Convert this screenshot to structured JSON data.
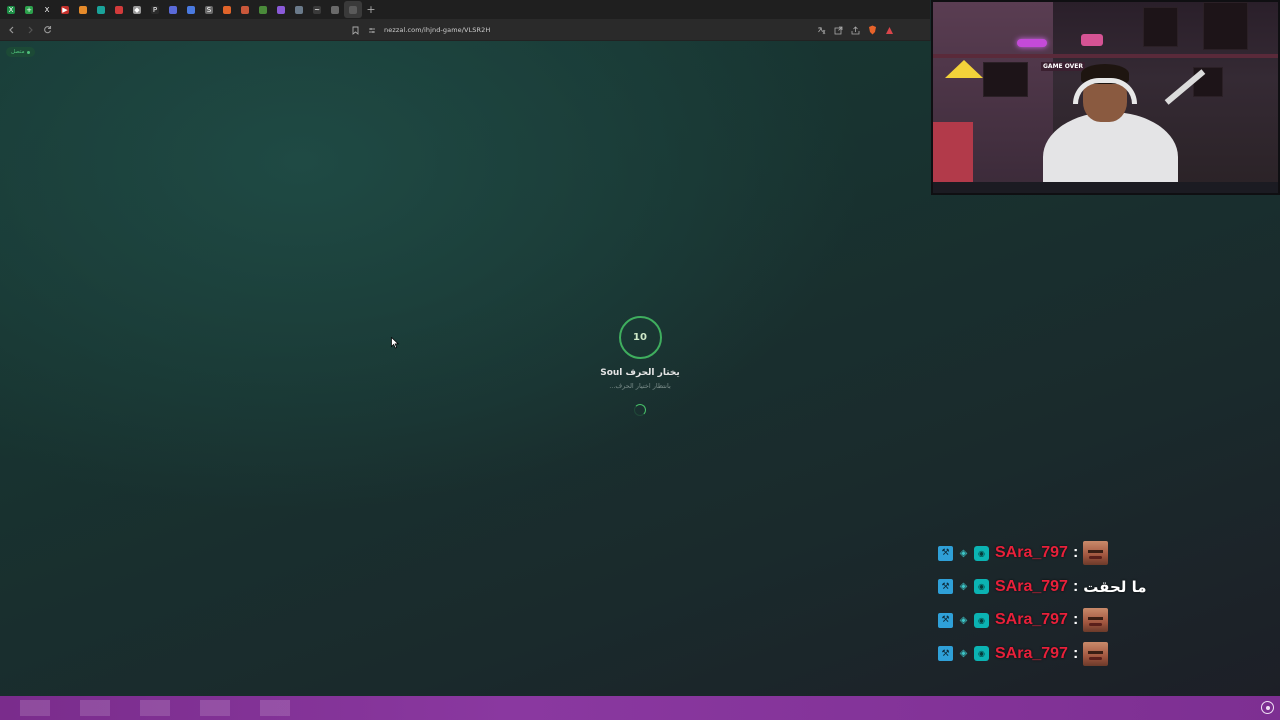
{
  "browser": {
    "tabs": [
      {
        "icon": "excel-icon",
        "color": "#1d8f46",
        "glyph": "X"
      },
      {
        "icon": "sheets-icon",
        "color": "#2ca24c",
        "glyph": "+"
      },
      {
        "icon": "x-twitter-icon",
        "color": "#1f1f1f",
        "glyph": "X"
      },
      {
        "icon": "youtube-icon",
        "color": "#c4302b",
        "glyph": "▶"
      },
      {
        "icon": "orange-site-icon",
        "color": "#e58a2a",
        "glyph": ""
      },
      {
        "icon": "teal-site-icon",
        "color": "#1aa39a",
        "glyph": ""
      },
      {
        "icon": "red-site-icon",
        "color": "#d33b3b",
        "glyph": ""
      },
      {
        "icon": "diamond-site-icon",
        "color": "#9a9a9a",
        "glyph": "◆"
      },
      {
        "icon": "p-site-icon",
        "color": "#2b2b2b",
        "glyph": "P"
      },
      {
        "icon": "gamepad-icon",
        "color": "#5a6ad8",
        "glyph": ""
      },
      {
        "icon": "globe-icon",
        "color": "#4a7ae0",
        "glyph": ""
      },
      {
        "icon": "sync-icon",
        "color": "#6a6a6a",
        "glyph": "S"
      },
      {
        "icon": "orange-ring-icon",
        "color": "#e0642a",
        "glyph": ""
      },
      {
        "icon": "brick-site-icon",
        "color": "#c9573a",
        "glyph": ""
      },
      {
        "icon": "map-site-icon",
        "color": "#4a8a3a",
        "glyph": ""
      },
      {
        "icon": "purple-game-icon",
        "color": "#8a5ad8",
        "glyph": ""
      },
      {
        "icon": "chat-site-icon",
        "color": "#6a7a8a",
        "glyph": ""
      },
      {
        "icon": "wave-site-icon",
        "color": "#3a3a3a",
        "glyph": "~"
      },
      {
        "icon": "grid-site-icon",
        "color": "#6a6a6a",
        "glyph": ""
      },
      {
        "icon": "active-tab-icon",
        "color": "#5a5a5a",
        "glyph": ""
      }
    ],
    "url": "nezzal.com/ihjnd-game/VLSR2H"
  },
  "page": {
    "status_label": "متصل",
    "timer": "10",
    "choosing_text": "Soul يختار الحرف",
    "waiting_text": "بانتظار اختيار الحرف..."
  },
  "webcam": {
    "sign_text": "GAME OVER"
  },
  "chat": {
    "messages": [
      {
        "username": "SAra_797",
        "type": "emote",
        "text": ""
      },
      {
        "username": "SAra_797",
        "type": "text",
        "text": "ما لحقت"
      },
      {
        "username": "SAra_797",
        "type": "emote",
        "text": ""
      },
      {
        "username": "SAra_797",
        "type": "emote",
        "text": ""
      }
    ],
    "separator": ":",
    "badges": [
      "mod-badge-icon",
      "vip-badge-icon",
      "sub-badge-icon"
    ]
  },
  "colors": {
    "accent_green": "#3fae5e",
    "username_red": "#e8203a",
    "bottom_bar_purple": "#8a38a0"
  }
}
